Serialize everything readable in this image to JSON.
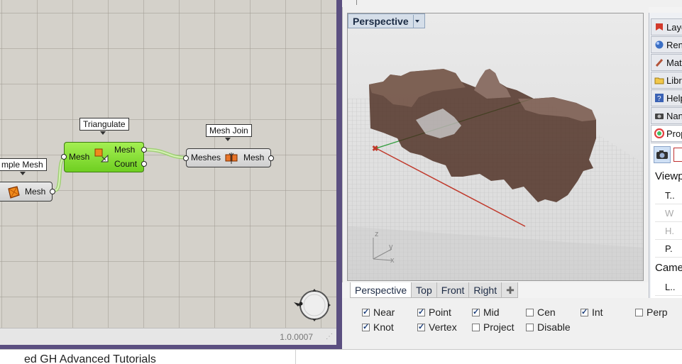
{
  "gh": {
    "version": "1.0.0007",
    "components": {
      "triangulate": {
        "label": "Triangulate",
        "input": "Mesh",
        "outputs": [
          "Mesh",
          "Count"
        ]
      },
      "mesh_join": {
        "label": "Mesh Join",
        "input": "Meshes",
        "output": "Mesh"
      },
      "simple_mesh": {
        "label": "mple Mesh",
        "output": "Mesh"
      }
    }
  },
  "below": {
    "text": "ed GH Advanced Tutorials"
  },
  "viewport": {
    "title": "Perspective",
    "axes": {
      "x": "x",
      "y": "y",
      "z": "z"
    }
  },
  "viewport_tabs": [
    "Perspective",
    "Top",
    "Front",
    "Right"
  ],
  "osnap": {
    "row1": [
      {
        "label": "Near",
        "checked": true
      },
      {
        "label": "Point",
        "checked": true
      },
      {
        "label": "Mid",
        "checked": true
      },
      {
        "label": "Cen",
        "checked": false
      },
      {
        "label": "Int",
        "checked": true
      },
      {
        "label": "Perp",
        "checked": false
      }
    ],
    "row2": [
      {
        "label": "Knot",
        "checked": true
      },
      {
        "label": "Vertex",
        "checked": true
      },
      {
        "label": "Project",
        "checked": false
      },
      {
        "label": "Disable",
        "checked": false
      }
    ]
  },
  "panel": {
    "tabs": [
      {
        "label": "Laye",
        "icon": "layers-icon"
      },
      {
        "label": "Renc",
        "icon": "render-icon"
      },
      {
        "label": "Mat",
        "icon": "material-icon"
      },
      {
        "label": "Libra",
        "icon": "library-icon"
      },
      {
        "label": "Help",
        "icon": "help-icon"
      },
      {
        "label": "Nan",
        "icon": "named-views-icon"
      },
      {
        "label": "Prop",
        "icon": "properties-icon"
      }
    ],
    "properties": {
      "viewport_header": "Viewp",
      "rows": [
        "T..",
        "W",
        "H.",
        "P."
      ],
      "camera_header": "Came",
      "camera_rows": [
        "L.."
      ]
    }
  }
}
